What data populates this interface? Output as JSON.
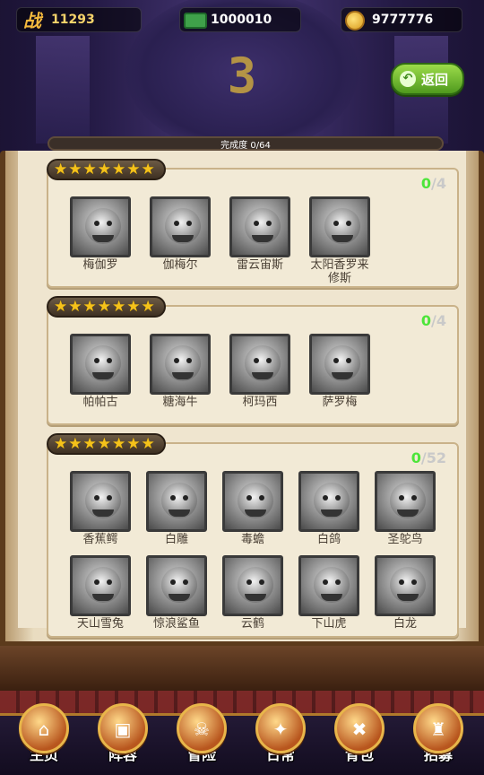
{
  "topbar": {
    "power_icon": "战",
    "power": "11293",
    "cash": "1000010",
    "gold": "9777776"
  },
  "stage": {
    "number": "3"
  },
  "back_button": {
    "label": "返回",
    "icon": "back-arrow-icon"
  },
  "progress": {
    "label": "完成度 0/64",
    "collected": 0,
    "total": 64
  },
  "sections": [
    {
      "stars": 7,
      "collected": "0",
      "total": "/4",
      "cards": [
        "梅伽罗",
        "伽梅尔",
        "雷云宙斯",
        "太阳香罗来修斯"
      ]
    },
    {
      "stars": 7,
      "collected": "0",
      "total": "/4",
      "cards": [
        "帕帕古",
        "糖海牛",
        "柯玛西",
        "萨罗梅"
      ]
    },
    {
      "stars": 7,
      "collected": "0",
      "total": "/52",
      "cards": [
        "香蕉鳄",
        "白雕",
        "毒蟾",
        "白鸽",
        "圣鸵鸟",
        "天山雪兔",
        "惊浪鲨鱼",
        "云鹤",
        "下山虎",
        "白龙"
      ]
    }
  ],
  "nav": [
    {
      "label": "主页",
      "icon": "home-icon"
    },
    {
      "label": "阵容",
      "icon": "lineup-icon"
    },
    {
      "label": "冒险",
      "icon": "adventure-icon"
    },
    {
      "label": "日常",
      "icon": "daily-icon"
    },
    {
      "label": "背包",
      "icon": "bag-icon"
    },
    {
      "label": "招募",
      "icon": "recruit-icon"
    }
  ],
  "colors": {
    "accent_green": "#4de53a",
    "star": "#f5c21a",
    "back_button": "#6fb82e"
  }
}
